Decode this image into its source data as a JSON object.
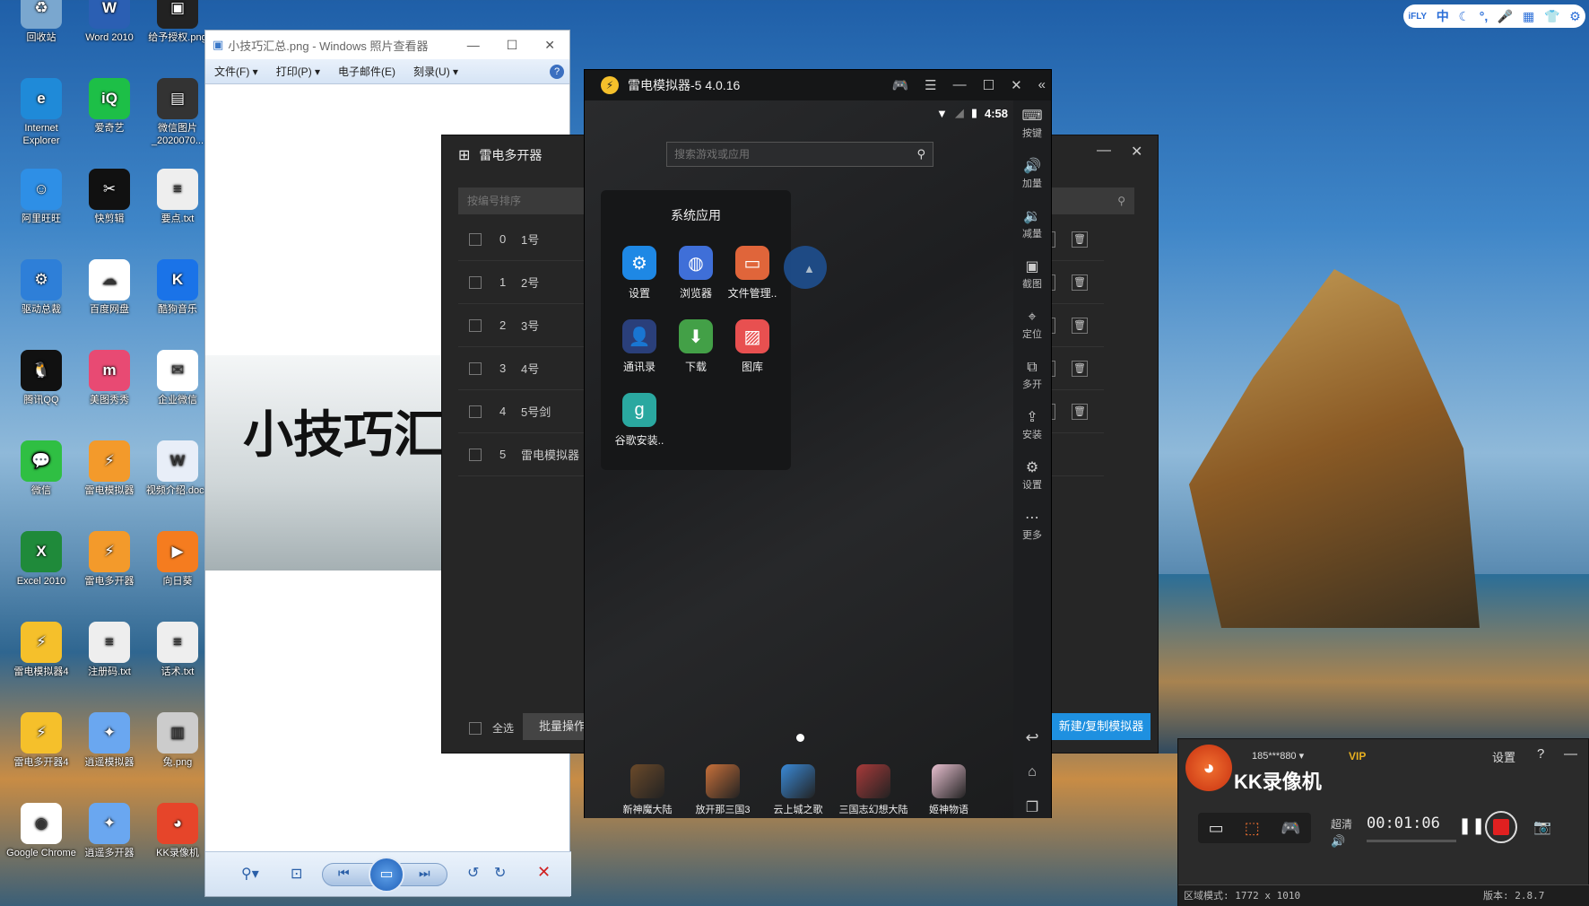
{
  "desktop": {
    "icons": [
      {
        "label": "回收站",
        "color": "#7aa7cf",
        "glyph": "♻"
      },
      {
        "label": "Word 2010",
        "color": "#2b5fb3",
        "glyph": "W"
      },
      {
        "label": "给予授权.png",
        "color": "#222",
        "glyph": "▣"
      },
      {
        "label": "Internet Explorer",
        "color": "#1f8ad8",
        "glyph": "e"
      },
      {
        "label": "爱奇艺",
        "color": "#1dbf47",
        "glyph": "iQ"
      },
      {
        "label": "微信图片_2020070...",
        "color": "#333",
        "glyph": "▤"
      },
      {
        "label": "阿里旺旺",
        "color": "#2e8fe6",
        "glyph": "☺"
      },
      {
        "label": "快剪辑",
        "color": "#111",
        "glyph": "✂"
      },
      {
        "label": "要点.txt",
        "color": "#eee",
        "glyph": "≡"
      },
      {
        "label": "驱动总裁",
        "color": "#2e7fd8",
        "glyph": "⚙"
      },
      {
        "label": "百度网盘",
        "color": "#fff",
        "glyph": "☁"
      },
      {
        "label": "酷狗音乐",
        "color": "#1a73e8",
        "glyph": "K"
      },
      {
        "label": "腾讯QQ",
        "color": "#111",
        "glyph": "🐧"
      },
      {
        "label": "美图秀秀",
        "color": "#e84a73",
        "glyph": "m"
      },
      {
        "label": "企业微信",
        "color": "#fff",
        "glyph": "✉"
      },
      {
        "label": "微信",
        "color": "#2fbf43",
        "glyph": "💬"
      },
      {
        "label": "雷电模拟器",
        "color": "#f39a2b",
        "glyph": "⚡"
      },
      {
        "label": "视频介绍.docx",
        "color": "#e8eef8",
        "glyph": "W"
      },
      {
        "label": "Excel 2010",
        "color": "#1f8a3a",
        "glyph": "X"
      },
      {
        "label": "雷电多开器",
        "color": "#f39a2b",
        "glyph": "⚡"
      },
      {
        "label": "向日葵",
        "color": "#f57c1f",
        "glyph": "▶"
      },
      {
        "label": "雷电模拟器4",
        "color": "#f5c02b",
        "glyph": "⚡"
      },
      {
        "label": "注册码.txt",
        "color": "#eee",
        "glyph": "≡"
      },
      {
        "label": "话术.txt",
        "color": "#eee",
        "glyph": "≡"
      },
      {
        "label": "雷电多开器4",
        "color": "#f5c02b",
        "glyph": "⚡"
      },
      {
        "label": "逍遥模拟器",
        "color": "#6aa7f0",
        "glyph": "✦"
      },
      {
        "label": "兔.png",
        "color": "#ccc",
        "glyph": "▥"
      },
      {
        "label": "Google Chrome",
        "color": "#fff",
        "glyph": "◉"
      },
      {
        "label": "逍遥多开器",
        "color": "#6aa7f0",
        "glyph": "✦"
      },
      {
        "label": "KK录像机",
        "color": "#e6452a",
        "glyph": "◕"
      }
    ]
  },
  "ifly": {
    "items": [
      "iFLY",
      "中",
      "☾",
      "°,",
      "🎤",
      "▦",
      "👕",
      "⚙"
    ]
  },
  "photo_viewer": {
    "title": "小技巧汇总.png - Windows 照片查看器",
    "menu": [
      "文件(F) ▾",
      "打印(P) ▾",
      "电子邮件(E)",
      "刻录(U) ▾"
    ],
    "image_text": "小技巧汇"
  },
  "multi": {
    "title": "雷电多开器",
    "sort_placeholder": "按编号排序",
    "rows": [
      {
        "index": "0",
        "name": "1号"
      },
      {
        "index": "1",
        "name": "2号"
      },
      {
        "index": "2",
        "name": "3号"
      },
      {
        "index": "3",
        "name": "4号"
      },
      {
        "index": "4",
        "name": "5号剑"
      },
      {
        "index": "5",
        "name": "雷电模拟器"
      }
    ],
    "select_all": "全选",
    "batch": "批量操作",
    "new_copy": "新建/复制模拟器"
  },
  "emulator": {
    "title": "雷电模拟器-5 4.0.16",
    "time": "4:58",
    "search_placeholder": "搜索游戏或应用",
    "folder_title": "系统应用",
    "apps": [
      {
        "label": "设置",
        "color": "#1e88e5",
        "glyph": "⚙"
      },
      {
        "label": "浏览器",
        "color": "#3f6fd8",
        "glyph": "◍"
      },
      {
        "label": "文件管理..",
        "color": "#e0653a",
        "glyph": "▭"
      },
      {
        "label": "通讯录",
        "color": "#2a3f7a",
        "glyph": "👤"
      },
      {
        "label": "下载",
        "color": "#43a047",
        "glyph": "⬇"
      },
      {
        "label": "图库",
        "color": "#e85050",
        "glyph": "▨"
      },
      {
        "label": "谷歌安装..",
        "color": "#2aa8a0",
        "glyph": "g"
      }
    ],
    "dock": [
      {
        "label": "新神魔大陆",
        "color": "#6b4a2a"
      },
      {
        "label": "放开那三国3",
        "color": "#c8703a"
      },
      {
        "label": "云上城之歌",
        "color": "#3a8ad8"
      },
      {
        "label": "三国志幻想大陆",
        "color": "#a83a3a"
      },
      {
        "label": "姬神物语",
        "color": "#e8c0d0"
      }
    ],
    "sidebar": [
      {
        "label": "按键",
        "glyph": "⌨"
      },
      {
        "label": "加量",
        "glyph": "🔊"
      },
      {
        "label": "减量",
        "glyph": "🔉"
      },
      {
        "label": "截图",
        "glyph": "▣"
      },
      {
        "label": "定位",
        "glyph": "⌖"
      },
      {
        "label": "多开",
        "glyph": "⧉"
      },
      {
        "label": "安装",
        "glyph": "⇪"
      },
      {
        "label": "设置",
        "glyph": "⚙"
      },
      {
        "label": "更多",
        "glyph": "⋯"
      }
    ]
  },
  "kk": {
    "user": "185***880",
    "vip": "VIP",
    "settings": "设置",
    "brand": "KK录像机",
    "quality": "超清",
    "timer": "00:01:06",
    "region": "区域模式: 1772 x 1010",
    "version": "版本: 2.8.7"
  }
}
